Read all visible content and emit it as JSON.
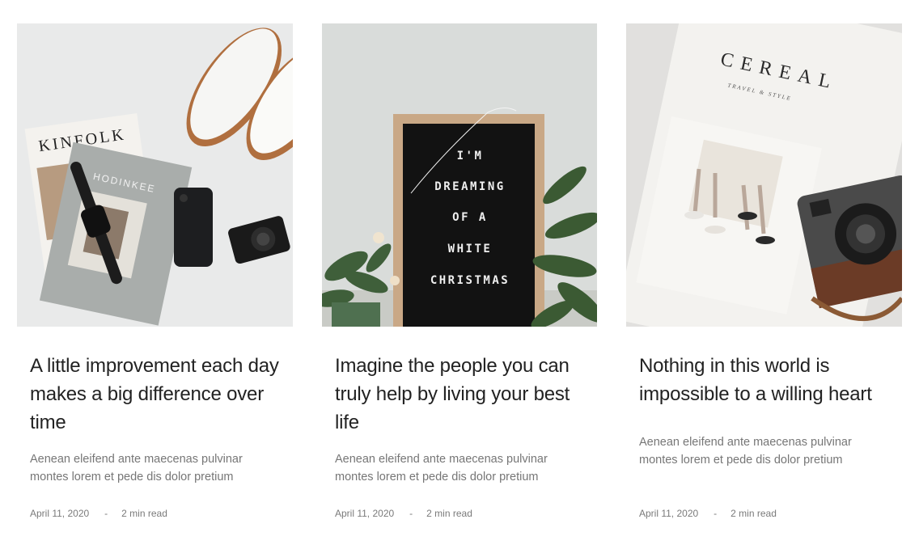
{
  "posts": [
    {
      "title": "A little improvement each day makes a big difference over time",
      "excerpt": "Aenean eleifend ante maecenas pulvinar montes lorem et pede dis dolor  pretium",
      "date": "April 11, 2020",
      "separator": "-",
      "read_time": "2 min read",
      "image_text": {
        "mag1": "KINFOLK",
        "mag2": "HODINKEE"
      }
    },
    {
      "title": "Imagine the people you can truly help by living your best life",
      "excerpt": "Aenean eleifend ante maecenas pulvinar montes lorem et pede dis dolor  pretium",
      "date": "April 11, 2020",
      "separator": "-",
      "read_time": "2 min read",
      "image_text": {
        "line1": "I'M",
        "line2": "DREAMING",
        "line3": "OF A",
        "line4": "WHITE",
        "line5": "CHRISTMAS"
      }
    },
    {
      "title": "Nothing in this world is impossible to a willing heart",
      "excerpt": "Aenean eleifend ante maecenas pulvinar montes lorem et pede dis dolor  pretium",
      "date": "April 11, 2020",
      "separator": "-",
      "read_time": "2 min read",
      "image_text": {
        "mag": "CEREAL",
        "sub": "TRAVEL & STYLE"
      }
    }
  ]
}
